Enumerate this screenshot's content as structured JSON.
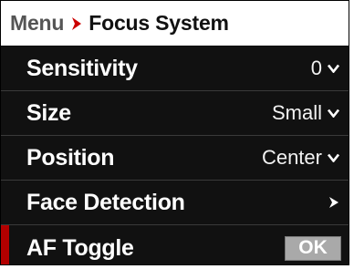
{
  "breadcrumb": {
    "parent": "Menu",
    "separator_icon": "chevron-right-icon",
    "current": "Focus System"
  },
  "menu": {
    "items": [
      {
        "label": "Sensitivity",
        "value": "0",
        "control": "dropdown",
        "icon": "chevron-down-icon"
      },
      {
        "label": "Size",
        "value": "Small",
        "control": "dropdown",
        "icon": "chevron-down-icon"
      },
      {
        "label": "Position",
        "value": "Center",
        "control": "dropdown",
        "icon": "chevron-down-icon"
      },
      {
        "label": "Face Detection",
        "value": "",
        "control": "submenu",
        "icon": "chevron-right-icon"
      },
      {
        "label": "AF Toggle",
        "value": "OK",
        "control": "button",
        "selected": true
      }
    ]
  },
  "colors": {
    "background": "#111111",
    "header_bg": "#ffffff",
    "accent": "#cc0000",
    "selected_bar": "#b30000",
    "ok_button_bg": "#a9a9a9"
  }
}
